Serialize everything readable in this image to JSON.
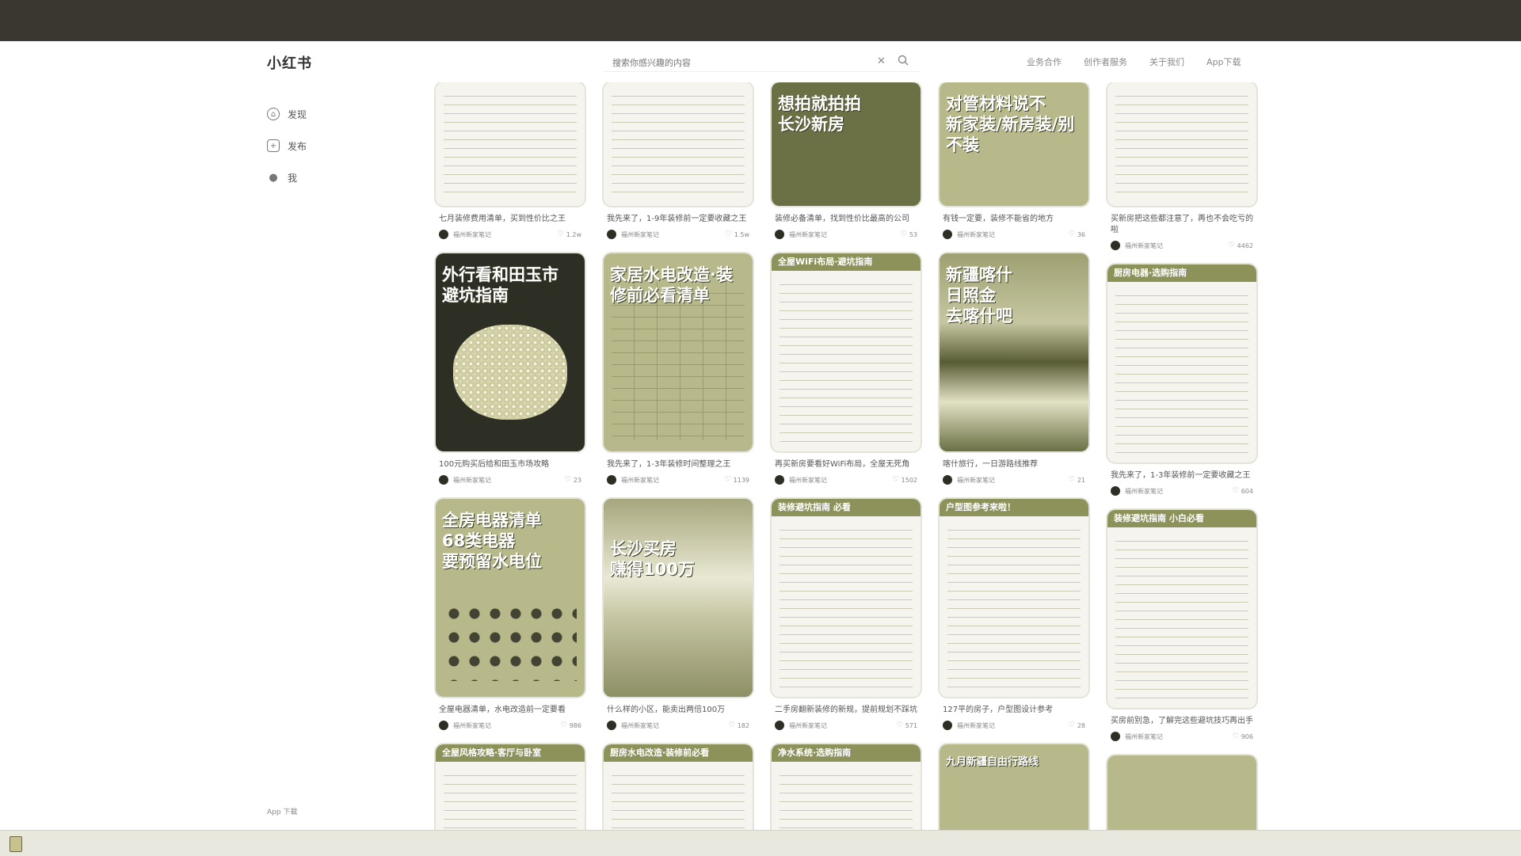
{
  "browser": {
    "tabs": [
      "",
      "",
      "",
      ""
    ],
    "url_text": ""
  },
  "header": {
    "logo": "小红书",
    "search_placeholder": "搜索你感兴趣的内容",
    "links": [
      "业务合作",
      "创作者服务",
      "关于我们",
      "App下载"
    ]
  },
  "sidebar": {
    "items": [
      {
        "label": "发现",
        "icon": "home-icon"
      },
      {
        "label": "发布",
        "icon": "plus-icon"
      },
      {
        "label": "我",
        "icon": "user-icon"
      }
    ],
    "footer": "App  下载"
  },
  "feed": {
    "columns": [
      [
        {
          "title": "七月装修费用清单，买到性价比之王",
          "author": "福州新家笔记",
          "likes": "1.2w",
          "cover_text": "",
          "kind": "doc",
          "h": 156
        },
        {
          "title": "100元购买后给和田玉市场攻略",
          "author": "福州新家笔记",
          "likes": "23",
          "cover_text": "外行看和田玉市\n避坑指南",
          "kind": "dark",
          "h": 250
        },
        {
          "title": "全屋电器清单，水电改造前一定要看",
          "author": "福州新家笔记",
          "likes": "986",
          "cover_text": "全房电器清单\n68类电器\n要预留水电位",
          "kind": "olive",
          "h": 250
        },
        {
          "title": "",
          "author": "",
          "likes": "",
          "cover_text": "全屋风格攻略·客厅与卧室",
          "kind": "doc",
          "h": 120
        }
      ],
      [
        {
          "title": "我先来了，1-9年装修前一定要收藏之王",
          "author": "福州新家笔记",
          "likes": "1.5w",
          "cover_text": "",
          "kind": "doc",
          "h": 156
        },
        {
          "title": "我先来了，1-3年装修时间整理之王",
          "author": "福州新家笔记",
          "likes": "1139",
          "cover_text": "家居水电改造·装修前必看清单",
          "kind": "olive",
          "h": 250
        },
        {
          "title": "什么样的小区，能卖出两倍100万",
          "author": "福州新家笔记",
          "likes": "182",
          "cover_text": "长沙买房\n赚得100万",
          "kind": "room",
          "h": 250
        },
        {
          "title": "",
          "author": "",
          "likes": "",
          "cover_text": "厨房水电改造·装修前必看",
          "kind": "doc",
          "h": 120
        }
      ],
      [
        {
          "title": "装修必备清单，找到性价比最高的公司",
          "author": "福州新家笔记",
          "likes": "53",
          "cover_text": "想拍就拍拍\n长沙新房",
          "kind": "photo",
          "h": 156
        },
        {
          "title": "再买新房要看好WiFi布局，全屋无死角",
          "author": "福州新家笔记",
          "likes": "1502",
          "cover_text": "全屋WiFi布局·避坑指南",
          "kind": "doc",
          "h": 250
        },
        {
          "title": "二手房翻新装修的新规，提前规划不踩坑",
          "author": "福州新家笔记",
          "likes": "571",
          "cover_text": "装修避坑指南\n必看",
          "kind": "doc",
          "h": 250
        },
        {
          "title": "",
          "author": "",
          "likes": "",
          "cover_text": "净水系统·选购指南",
          "kind": "doc",
          "h": 120
        }
      ],
      [
        {
          "title": "有钱一定要，装修不能省的地方",
          "author": "福州新家笔记",
          "likes": "36",
          "cover_text": "对管材料说不\n新家装/新房装/别不装",
          "kind": "olive",
          "h": 156
        },
        {
          "title": "喀什旅行，一日游路线推荐",
          "author": "福州新家笔记",
          "likes": "21",
          "cover_text": "新疆喀什\n日照金\n去喀什吧",
          "kind": "scene",
          "h": 250
        },
        {
          "title": "127平的房子，户型图设计参考",
          "author": "福州新家笔记",
          "likes": "28",
          "cover_text": "户型图参考来啦！",
          "kind": "doc",
          "h": 250
        },
        {
          "title": "",
          "author": "",
          "likes": "",
          "cover_text": "九月新疆自由行路线",
          "kind": "olive",
          "h": 120
        }
      ],
      [
        {
          "title": "买新房把这些都注意了，再也不会吃亏的啦",
          "author": "福州新家笔记",
          "likes": "4462",
          "cover_text": "",
          "kind": "doc",
          "h": 156
        },
        {
          "title": "我先来了，1-3年装修前一定要收藏之王",
          "author": "福州新家笔记",
          "likes": "604",
          "cover_text": "厨房电器·选购指南",
          "kind": "doc",
          "h": 250
        },
        {
          "title": "买房前别急，了解完这些避坑技巧再出手",
          "author": "福州新家笔记",
          "likes": "906",
          "cover_text": "装修避坑指南\n小白必看",
          "kind": "doc",
          "h": 250
        },
        {
          "title": "",
          "author": "",
          "likes": "",
          "cover_text": "",
          "kind": "olive",
          "h": 120
        }
      ]
    ]
  },
  "colors": {
    "titlebar": "#3a3730",
    "accent_olive": "#8d915a",
    "dark": "#2d2e24"
  }
}
